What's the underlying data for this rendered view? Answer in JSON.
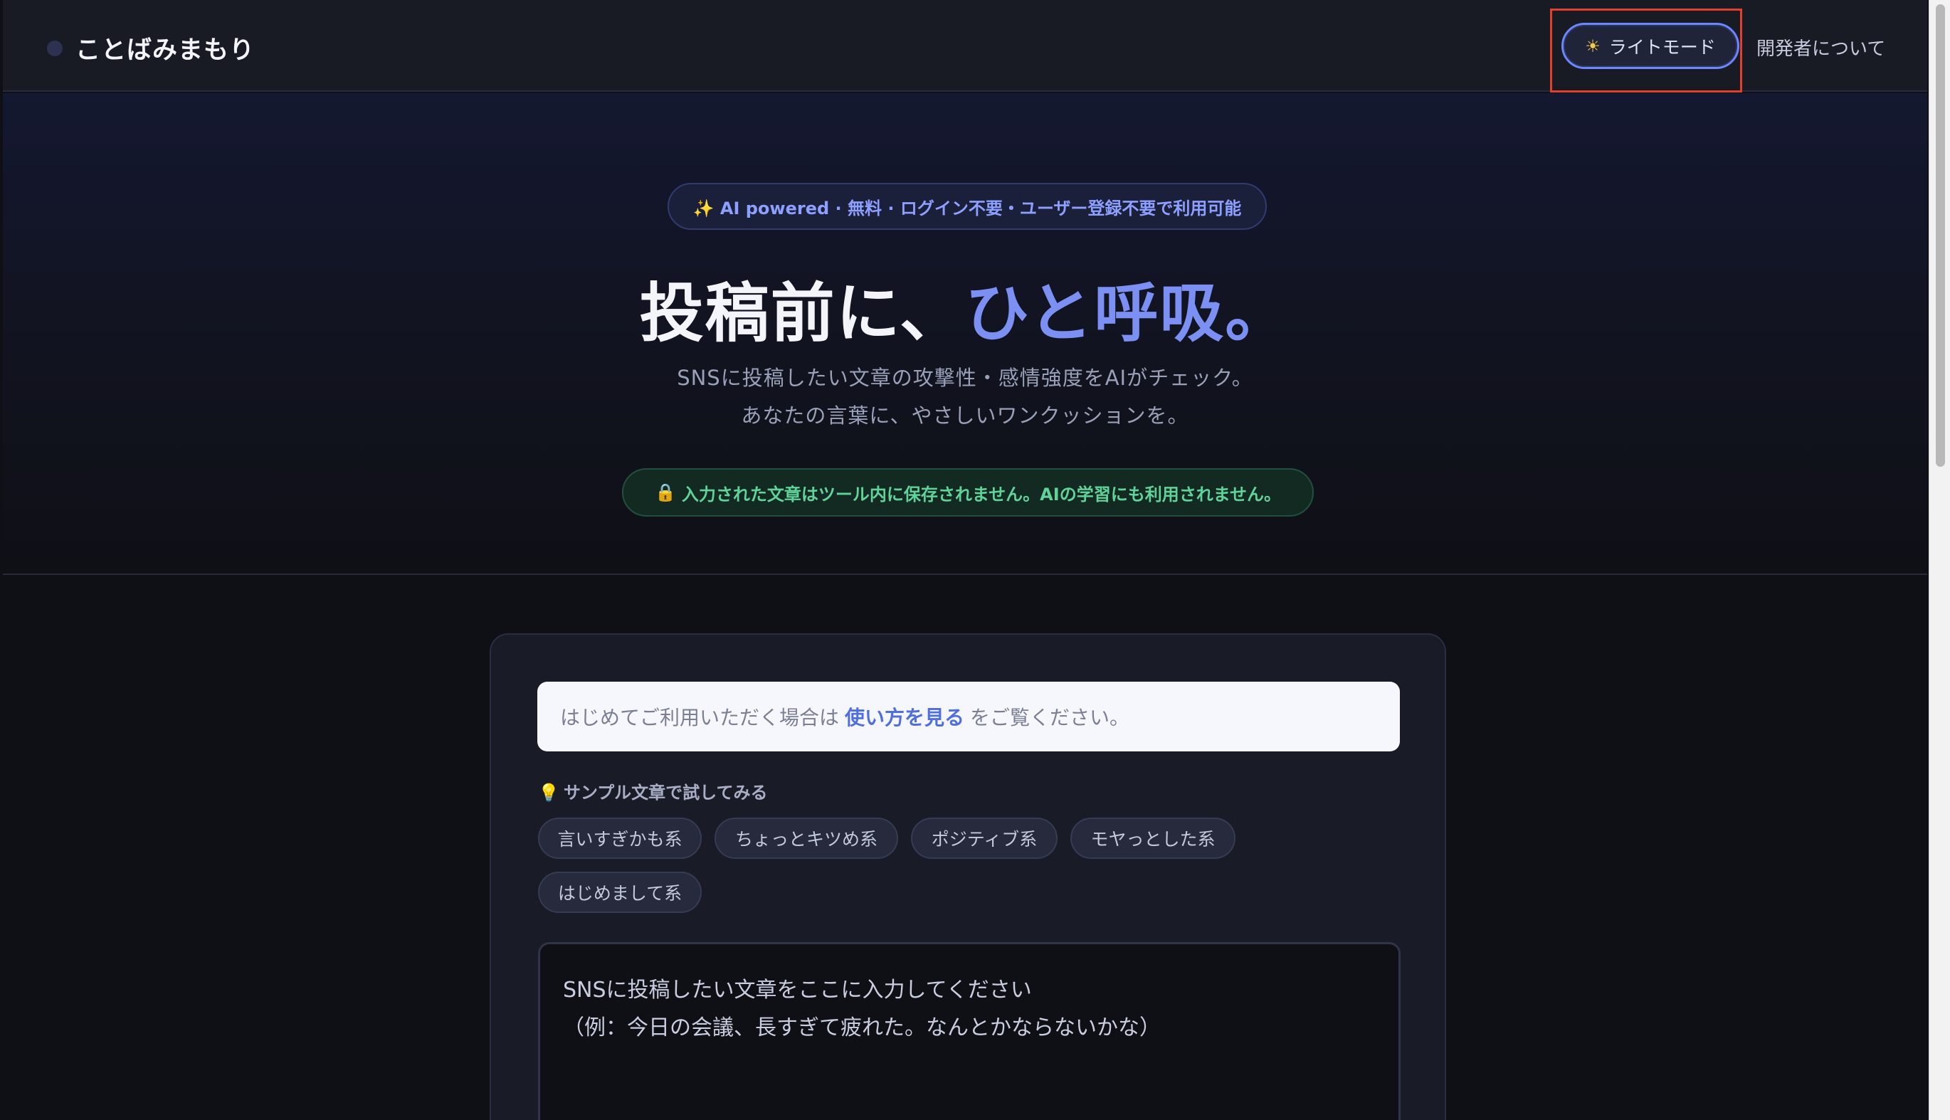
{
  "header": {
    "brand": "ことばみまもり",
    "mode_toggle_icon": "sun-icon",
    "mode_toggle_label": "ライトモード",
    "about_label": "開発者について"
  },
  "hero": {
    "badge": "✨ AI powered · 無料 · ログイン不要・ユーザー登録不要で利用可能",
    "headline_main": "投稿前に、",
    "headline_accent": "ひと呼吸。",
    "subtitle_line1": "SNSに投稿したい文章の攻撃性・感情強度をAIがチェック。",
    "subtitle_line2": "あなたの言葉に、やさしいワンクッションを。",
    "privacy_icon": "lock-icon",
    "privacy_text": "入力された文章はツール内に保存されません。AIの学習にも利用されません。"
  },
  "card": {
    "notice_prefix": "はじめてご利用いただく場合は",
    "notice_link": "使い方を見る",
    "notice_suffix": "をご覧ください。",
    "samples_icon": "lightbulb-icon",
    "samples_title": "サンプル文章で試してみる",
    "samples": [
      "言いすぎかも系",
      "ちょっとキツめ系",
      "ポジティブ系",
      "モヤっとした系",
      "はじめまして系"
    ],
    "input_placeholder": "SNSに投稿したい文章をここに入力してください\n（例：今日の会議、長すぎて疲れた。なんとかならないかな）"
  },
  "colors": {
    "accent": "#7b90f2",
    "background": "#0f1016",
    "privacy_green": "#5fd39a",
    "highlight_box": "#e0402c"
  }
}
